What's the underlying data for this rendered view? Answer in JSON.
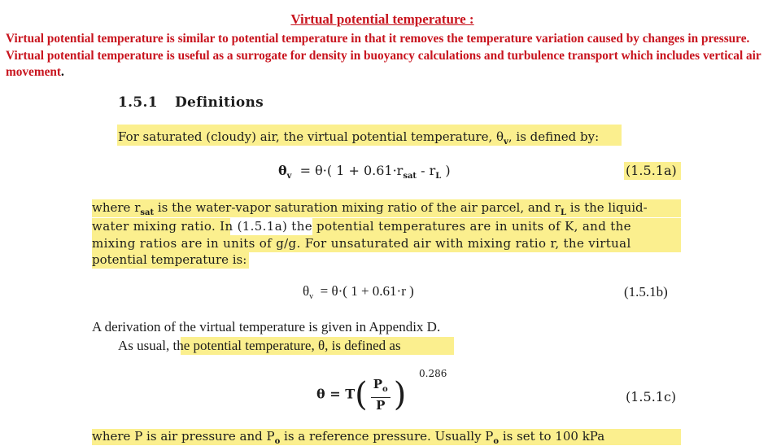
{
  "slide": {
    "title": "Virtual potential temperature :",
    "intro_text": "Virtual potential temperature is similar to potential temperature in that it removes the temperature variation caused by changes in pressure. Virtual potential temperature is useful as a surrogate for density in buoyancy calculations and turbulence transport which includes vertical air movement",
    "intro_period": ".",
    "colors": {
      "title_red": "#c8141e",
      "highlight": "#fbef8e"
    }
  },
  "excerpt": {
    "section_number": "1.5.1",
    "section_title": "Definitions",
    "p1": "For saturated (cloudy) air, the virtual potential temperature, θ",
    "p1_sub": "v",
    "p1_end": ", is defined by:",
    "eq_a": {
      "lhs": "θ",
      "lhs_sub": "v",
      "rhs_1": "=  θ·( 1  +  0.61·r",
      "rhs_sub1": "sat",
      "rhs_2": "  -  r",
      "rhs_sub2": "L",
      "rhs_3": " )",
      "label": "(1.5.1a)"
    },
    "p2_lines": [
      {
        "a": "where r",
        "sub": "sat",
        "b": "  is the water-vapor saturation mixing ratio of the air parcel, and r",
        "sub2": "L",
        "c": " is the liquid-"
      },
      {
        "a": "water mixing ratio.  In (1.5.1a) the potential temperatures are in units of  K, and the"
      },
      {
        "a": "mixing ratios are in units of  g/g.  For unsaturated air with mixing ratio r, the virtual"
      },
      {
        "a": "potential temperature is:"
      }
    ],
    "eq_b": {
      "lhs": "θ",
      "lhs_sub": "v",
      "rhs": "=  θ·( 1  +  0.61·r )",
      "label": "(1.5.1b)"
    },
    "p3": "A derivation of the virtual temperature is given in Appendix D.",
    "p4_plain": "As usual, ",
    "p4_hl": "the potential temperature, θ, is defined as",
    "eq_c": {
      "lhs": "θ  =  T",
      "numerator": "P",
      "numerator_sub": "o",
      "denominator": "P",
      "exponent": "0.286",
      "label": "(1.5.1c)"
    },
    "p5": "where P is air pressure and  P",
    "p5_sub": "o",
    "p5_mid": "  is a reference pressure. Usually  P",
    "p5_sub2": "o",
    "p5_end": "  is set to 100 kPa"
  }
}
